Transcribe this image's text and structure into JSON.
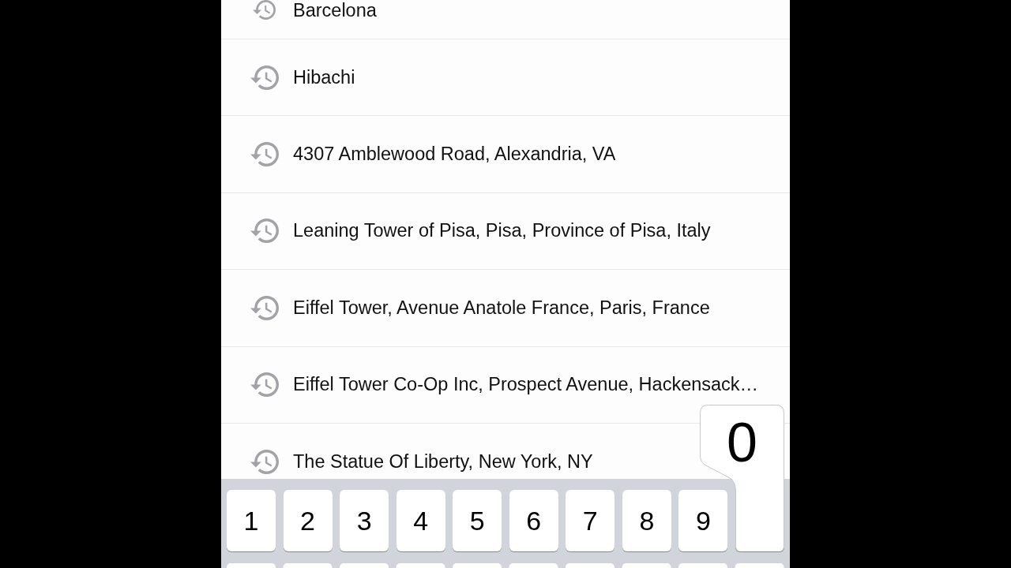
{
  "history": [
    {
      "label": "Barcelona"
    },
    {
      "label": "Hibachi"
    },
    {
      "label": "4307 Amblewood Road, Alexandria, VA"
    },
    {
      "label": "Leaning Tower of Pisa, Pisa, Province of Pisa, Italy"
    },
    {
      "label": "Eiffel Tower, Avenue Anatole France, Paris, France"
    },
    {
      "label": "Eiffel Tower Co-Op Inc, Prospect Avenue, Hackensack…"
    },
    {
      "label": "The Statue Of Liberty, New York, NY"
    }
  ],
  "keyboard": {
    "number_row": [
      {
        "label": "1",
        "pressed": false
      },
      {
        "label": "2",
        "pressed": false
      },
      {
        "label": "3",
        "pressed": false
      },
      {
        "label": "4",
        "pressed": false
      },
      {
        "label": "5",
        "pressed": false
      },
      {
        "label": "6",
        "pressed": false
      },
      {
        "label": "7",
        "pressed": false
      },
      {
        "label": "8",
        "pressed": false
      },
      {
        "label": "9",
        "pressed": false
      },
      {
        "label": "0",
        "pressed": true
      }
    ]
  }
}
